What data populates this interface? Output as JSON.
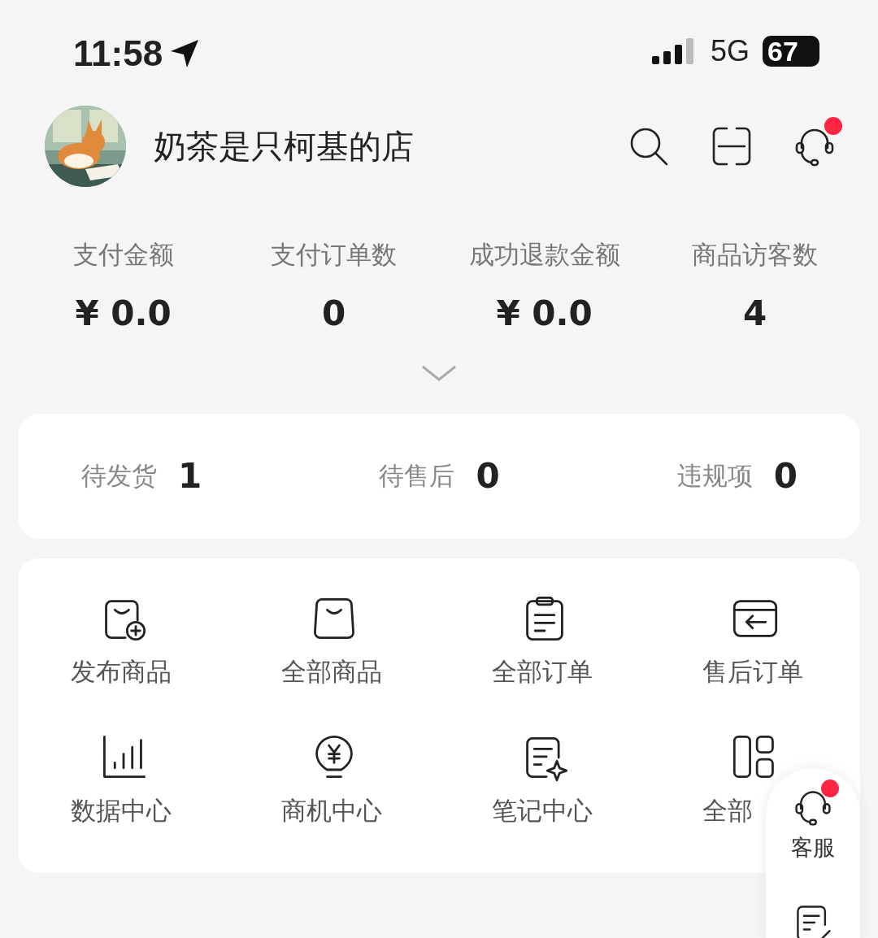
{
  "status_bar": {
    "time": "11:58",
    "network": "5G",
    "battery": "67"
  },
  "shop": {
    "name": "奶茶是只柯基的店"
  },
  "header_actions": [
    {
      "kind": "search",
      "has_badge": false
    },
    {
      "kind": "scan",
      "has_badge": false
    },
    {
      "kind": "service",
      "has_badge": true
    }
  ],
  "stats": [
    {
      "label": "支付金额",
      "value": "¥ 0.0"
    },
    {
      "label": "支付订单数",
      "value": "0"
    },
    {
      "label": "成功退款金额",
      "value": "¥ 0.0"
    },
    {
      "label": "商品访客数",
      "value": "4"
    }
  ],
  "stats_expanded": false,
  "todo": [
    {
      "label": "待发货",
      "count": "1"
    },
    {
      "label": "待售后",
      "count": "0"
    },
    {
      "label": "违规项",
      "count": "0"
    }
  ],
  "tools": [
    {
      "kind": "publish",
      "label": "发布商品"
    },
    {
      "kind": "goods",
      "label": "全部商品"
    },
    {
      "kind": "orders",
      "label": "全部订单"
    },
    {
      "kind": "aftersale",
      "label": "售后订单"
    },
    {
      "kind": "data",
      "label": "数据中心"
    },
    {
      "kind": "opportunity",
      "label": "商机中心"
    },
    {
      "kind": "notes",
      "label": "笔记中心"
    },
    {
      "kind": "all",
      "label": "全部"
    }
  ],
  "float_panel": [
    {
      "kind": "service",
      "label": "客服",
      "has_badge": true
    },
    {
      "kind": "note"
    }
  ]
}
